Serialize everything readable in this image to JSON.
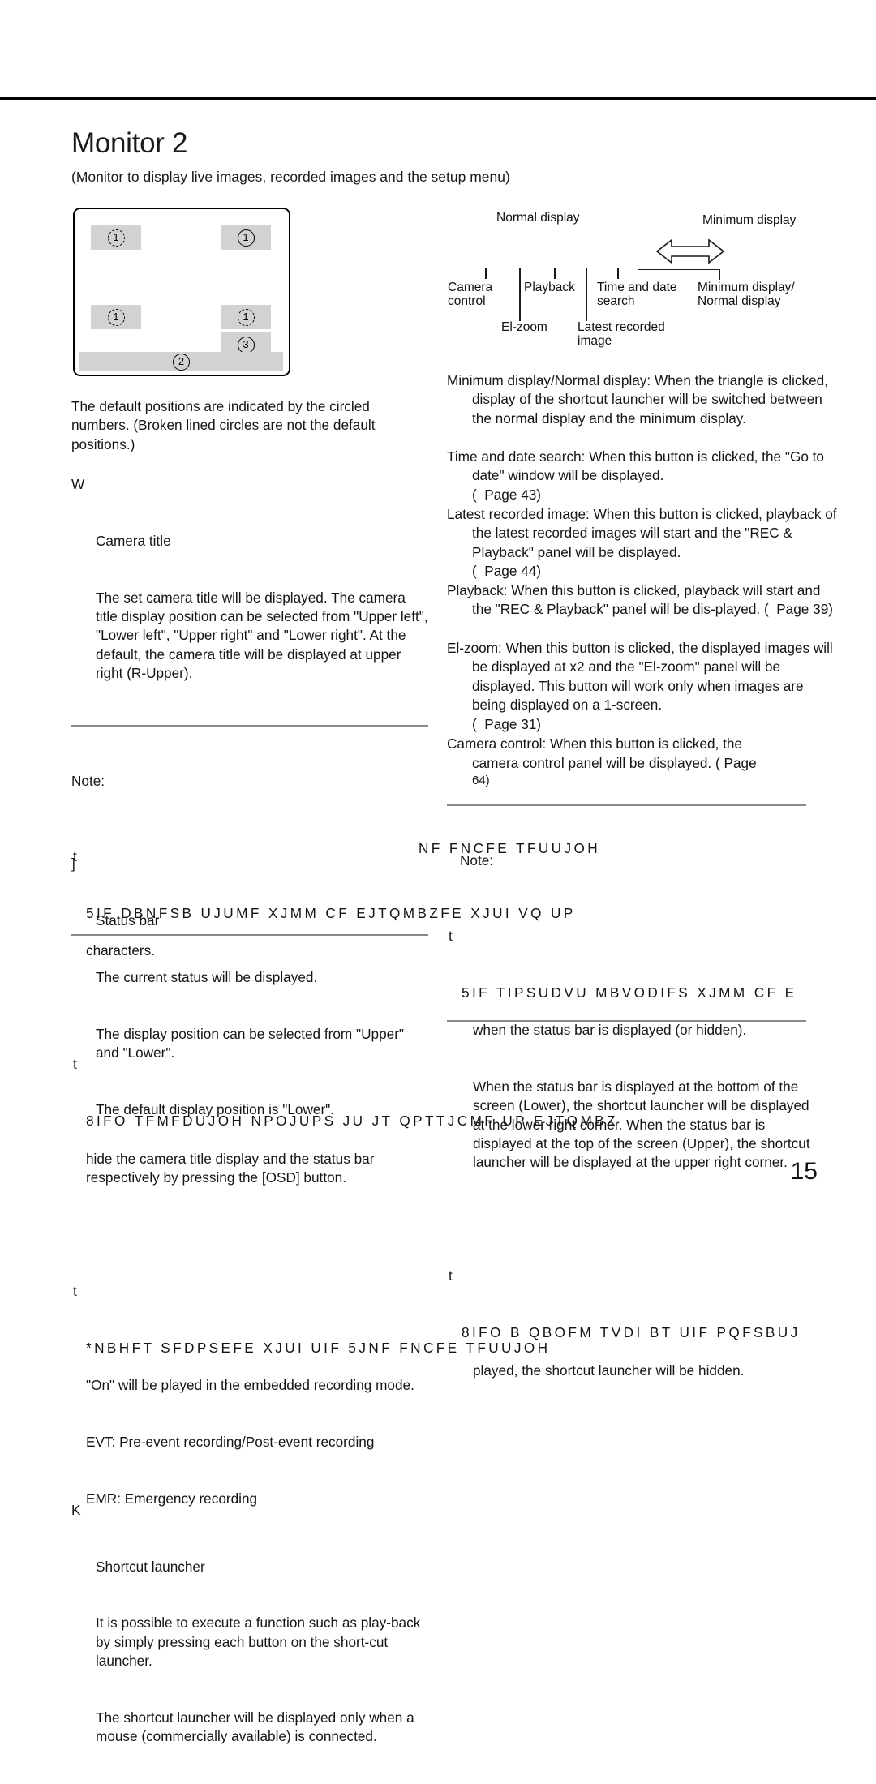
{
  "page": {
    "title": "Monitor 2",
    "subtitle": "(Monitor to display live images, recorded images and the setup menu)",
    "number": "15"
  },
  "monitor_diagram": {
    "slot_upper_left": "1",
    "slot_upper_right": "1",
    "slot_lower_left": "1",
    "slot_lower_right": "1",
    "slot_lower_right_2": "3",
    "status_bar": "2"
  },
  "callout": {
    "normal_display": "Normal display",
    "minimum_display": "Minimum display",
    "camera_control": "Camera\ncontrol",
    "playback": "Playback",
    "time_and_date_search": "Time and date\nsearch",
    "minimum_normal_display": "Minimum display/\nNormal display",
    "el_zoom": "El-zoom",
    "latest_recorded_image": "Latest recorded\nimage"
  },
  "left_column": {
    "intro": "The default positions are indicated by the circled numbers. (Broken lined circles are not the default positions.)",
    "items": [
      {
        "marker": "W",
        "title": "Camera title",
        "body": "The set camera title will be displayed. The camera title display position can be selected from \"Upper left\", \"Lower left\", \"Upper right\" and \"Lower right\". At the default, the camera title will be displayed at upper right (R-Upper)."
      },
      {
        "marker": "]",
        "title": "Status bar",
        "body_lines": [
          "The current status will be displayed.",
          "The display position can be selected from \"Upper\" and \"Lower\".",
          "The default display position is \"Lower\"."
        ]
      },
      {
        "marker": "K",
        "title": "Shortcut launcher",
        "body_lines": [
          "It is possible to execute a function such as play-back by simply pressing each button on the short-cut launcher.",
          "The shortcut launcher will be displayed only when a mouse (commercially available) is connected."
        ]
      }
    ],
    "note": {
      "label": "Note:",
      "bullet_marker": "t",
      "bullets": [
        {
          "garbled": "5IF  DBNFSB  UJUMF  XJMM  CF  EJTQMBZFE  XJUI  VQ  UP",
          "tail": "characters."
        },
        {
          "garbled": "8IFO  TFMFDUJOH  NPOJUPS      JU  JT  QPTTJCMF  UP  EJTQMBZ",
          "tail": "hide the camera title display and the status bar respectively by pressing the [OSD] button."
        },
        {
          "garbled": "*NBHFT  SFDPSEFE  XJUI  UIF   5JNF  FNCFE   TFUUJOH",
          "tail_lines": [
            "\"On\" will be played in the embedded recording mode.",
            "EVT: Pre-event recording/Post-event recording",
            "EMR: Emergency recording"
          ]
        }
      ]
    }
  },
  "right_column": {
    "entries": [
      {
        "term": "Minimum display/Normal display:",
        "text": "Minimum display/Normal display: When the triangle is clicked, display of the shortcut launcher will be switched between the normal display and the minimum display."
      },
      {
        "term": "Time and date search:",
        "text": "Time and date search: When this button is clicked, the \"Go to date\" window will be displayed.",
        "ref": "(  Page 43)"
      },
      {
        "term": "Latest recorded image:",
        "text": "Latest recorded image: When this button is clicked, playback of the latest recorded images will start and the \"REC & Playback\" panel will be displayed.",
        "ref": "(  Page 44)"
      },
      {
        "term": "Playback:",
        "text": "Playback: When this button is clicked, playback will start and the \"REC & Playback\" panel will be dis-played. (  Page 39)"
      },
      {
        "term": "El-zoom:",
        "text": "El-zoom: When this button is clicked, the displayed images will be displayed at x2 and the \"El-zoom\" panel will be displayed. This button will work only when images are being displayed on a 1-screen.",
        "ref": "(  Page 31)"
      },
      {
        "term": "Camera control:",
        "text": "Camera control: When this button is clicked, the camera control panel will be displayed. (  Page 64)"
      }
    ],
    "note": {
      "label": "Note:",
      "bullet_marker": "t",
      "bullets": [
        {
          "garbled": "5IF  TIPSUDVU  MBVODIFS  XJMM  CF  E",
          "tail_lines": [
            "when the status bar is displayed (or hidden).",
            "When the status bar is displayed at the bottom of the screen (Lower), the shortcut launcher will be displayed at the lower right corner. When the status bar is displayed at the top of the screen (Upper), the shortcut launcher will be displayed at the upper right corner."
          ]
        },
        {
          "garbled": "8IFO  B  QBOFM  TVDI  BT  UIF  PQFSBUJ",
          "tail": "played, the shortcut launcher will be hidden."
        }
      ]
    }
  },
  "overlap_fragments": {
    "camera_control_line1": "Camera control: When this button is clicked, the",
    "camera_control_line2": "camera control panel will be displayed. (   Page",
    "camera_control_line3": "64)",
    "note_garbled_overflow_1": "NF  FNCFE  TFUUJOH",
    "note_garbled_overflow_2": "played, the shortcut launcher will be hidden."
  }
}
